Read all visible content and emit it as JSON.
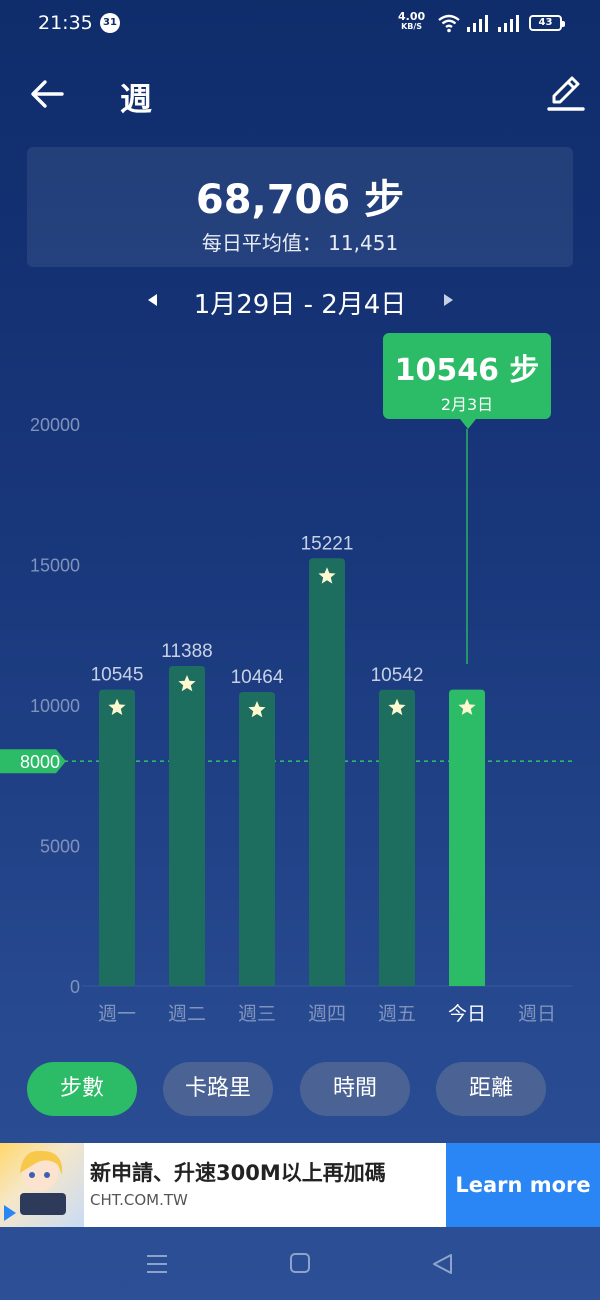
{
  "status_bar": {
    "time": "21:35",
    "calendar_badge": "31",
    "net_speed": "4.00",
    "net_unit": "KB/S",
    "battery": "43"
  },
  "header": {
    "title": "週",
    "back_icon": "arrow-left-icon",
    "edit_icon": "pencil-icon"
  },
  "summary": {
    "total_label": "68,706 步",
    "average_label": "每日平均值：  11,451"
  },
  "date_nav": {
    "range": "1月29日 - 2月4日",
    "prev_icon": "triangle-left-icon",
    "next_icon": "triangle-right-icon"
  },
  "tooltip": {
    "steps": "10546 步",
    "date": "2月3日"
  },
  "colors": {
    "bar": "#1d6e5e",
    "bar_today": "#2cbb66",
    "goal_line": "#2cbb66",
    "star": "#fdf8cf"
  },
  "chart_data": {
    "type": "bar",
    "categories": [
      "週一",
      "週二",
      "週三",
      "週四",
      "週五",
      "今日",
      "週日"
    ],
    "values": [
      10545,
      11388,
      10464,
      15221,
      10542,
      10546,
      null
    ],
    "value_labels": [
      "10545",
      "11388",
      "10464",
      "15221",
      "10542",
      "",
      ""
    ],
    "highlight_index": 5,
    "goal": 8000,
    "goal_label": "8000",
    "ylim": [
      0,
      20000
    ],
    "yticks": [
      "0",
      "5000",
      "10000",
      "15000",
      "20000"
    ],
    "title": "",
    "xlabel": "",
    "ylabel": ""
  },
  "tabs": [
    {
      "label": "步數",
      "active": true
    },
    {
      "label": "卡路里",
      "active": false
    },
    {
      "label": "時間",
      "active": false
    },
    {
      "label": "距離",
      "active": false
    }
  ],
  "ad": {
    "title": "新申請、升速300M以上再加碼",
    "url": "CHT.COM.TW",
    "button": "Learn more"
  },
  "nav_icons": [
    "menu-icon",
    "home-icon",
    "back-triangle-icon"
  ]
}
